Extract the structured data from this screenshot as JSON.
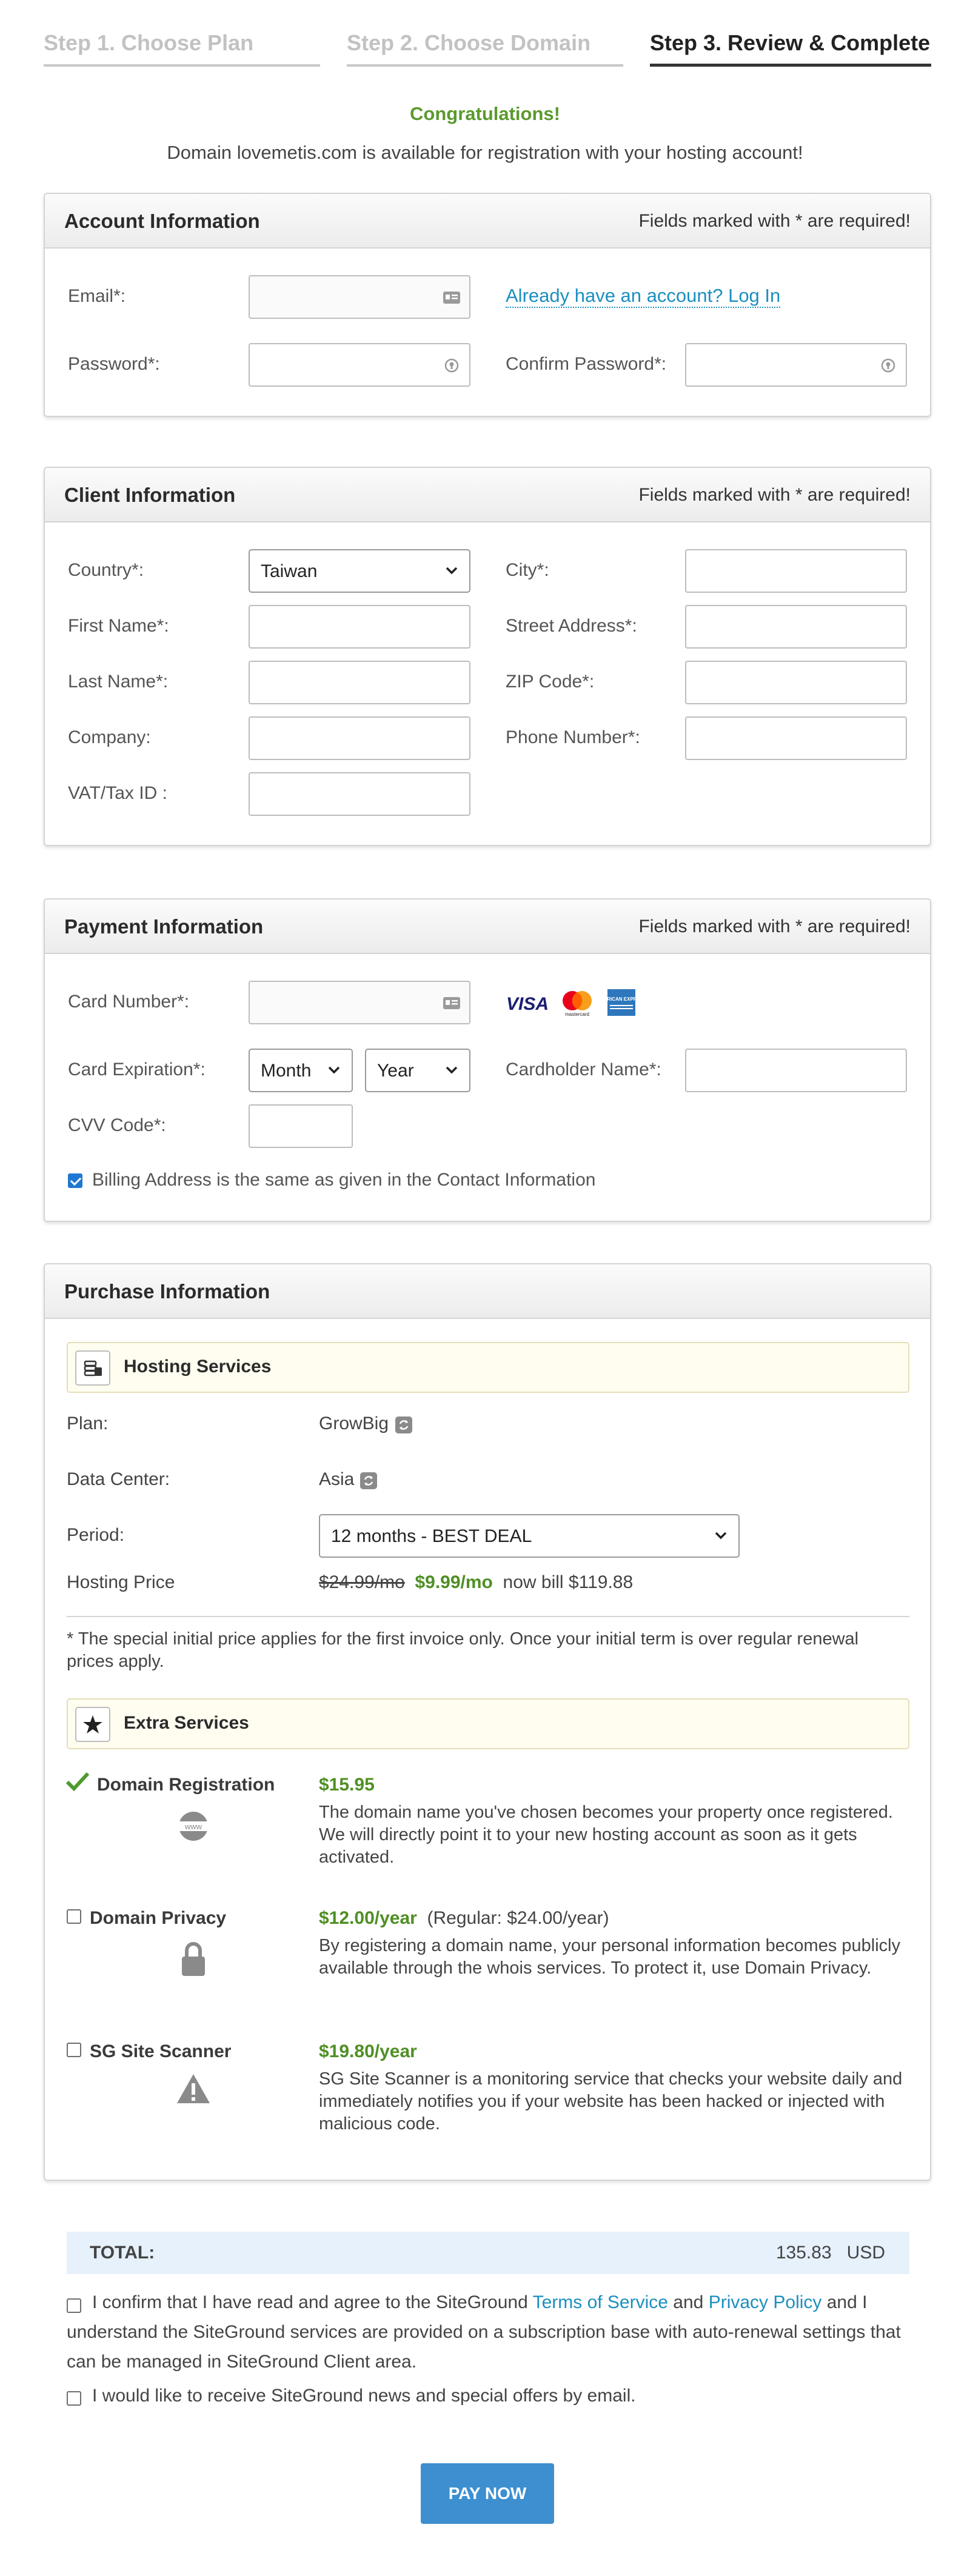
{
  "steps": [
    {
      "label": "Step 1. Choose Plan",
      "active": false
    },
    {
      "label": "Step 2. Choose Domain",
      "active": false
    },
    {
      "label": "Step 3. Review & Complete",
      "active": true
    }
  ],
  "congrats": "Congratulations!",
  "availability": "Domain lovemetis.com is available for registration with your hosting account!",
  "required_note": "Fields marked with * are required!",
  "account": {
    "title": "Account Information",
    "email_label": "Email*:",
    "email_value": "",
    "login_link": "Already have an account? Log In",
    "password_label": "Password*:",
    "confirm_label": "Confirm Password*:"
  },
  "client": {
    "title": "Client Information",
    "country_label": "Country*:",
    "country_value": "Taiwan",
    "city_label": "City*:",
    "first_name_label": "First Name*:",
    "street_label": "Street Address*:",
    "last_name_label": "Last Name*:",
    "zip_label": "ZIP Code*:",
    "company_label": "Company:",
    "phone_label": "Phone Number*:",
    "vat_label": "VAT/Tax ID :"
  },
  "payment": {
    "title": "Payment Information",
    "card_number_label": "Card Number*:",
    "card_brands": [
      "VISA",
      "mastercard",
      "AMERICAN EXPRESS"
    ],
    "expiration_label": "Card Expiration*:",
    "month_value": "Month",
    "year_value": "Year",
    "cardholder_label": "Cardholder Name*:",
    "cvv_label": "CVV Code*:",
    "billing_same_label": "Billing Address is the same as given in the Contact Information",
    "billing_same_checked": true
  },
  "purchase": {
    "title": "Purchase Information",
    "hosting_title": "Hosting Services",
    "plan_label": "Plan:",
    "plan_value": "GrowBig",
    "datacenter_label": "Data Center:",
    "datacenter_value": "Asia",
    "period_label": "Period:",
    "period_value": "12 months - BEST DEAL",
    "price_label": "Hosting Price",
    "price_old": "$24.99/mo",
    "price_new": "$9.99/mo",
    "price_bill": "now bill $119.88",
    "note": "* The special initial price applies for the first invoice only. Once your initial term is over regular renewal prices apply.",
    "extra_title": "Extra Services",
    "extras": [
      {
        "name": "Domain Registration",
        "price": "$15.95",
        "regular": "",
        "checked": true,
        "icon_text": "www",
        "description": "The domain name you've chosen becomes your property once registered. We will directly point it to your new hosting account as soon as it gets activated."
      },
      {
        "name": "Domain Privacy",
        "price": "$12.00/year",
        "regular": "(Regular: $24.00/year)",
        "checked": false,
        "icon_text": "",
        "description": "By registering a domain name, your personal information becomes publicly available through the whois services. To protect it, use Domain Privacy."
      },
      {
        "name": "SG Site Scanner",
        "price": "$19.80/year",
        "regular": "",
        "checked": false,
        "icon_text": "",
        "description": "SG Site Scanner is a monitoring service that checks your website daily and immediately notifies you if your website has been hacked or injected with malicious code."
      }
    ]
  },
  "total": {
    "label": "TOTAL:",
    "amount": "135.83",
    "currency": "USD"
  },
  "terms": {
    "part1": "I confirm that I have read and agree to the SiteGround ",
    "tos_link": "Terms of Service",
    "and": " and ",
    "privacy_link": "Privacy Policy",
    "part2": " and I understand the SiteGround services are provided on a subscription base with auto-renewal settings that can be managed in SiteGround Client area.",
    "news_label": "I would like to receive SiteGround news and special offers by email."
  },
  "pay_button": "PAY NOW",
  "colors": {
    "accent_green": "#4f8f24",
    "link_blue": "#1b8fbf",
    "pay_blue": "#3d8fcf",
    "total_bg": "#e6f1fb",
    "hosting_box_bg": "#fffdf0"
  }
}
